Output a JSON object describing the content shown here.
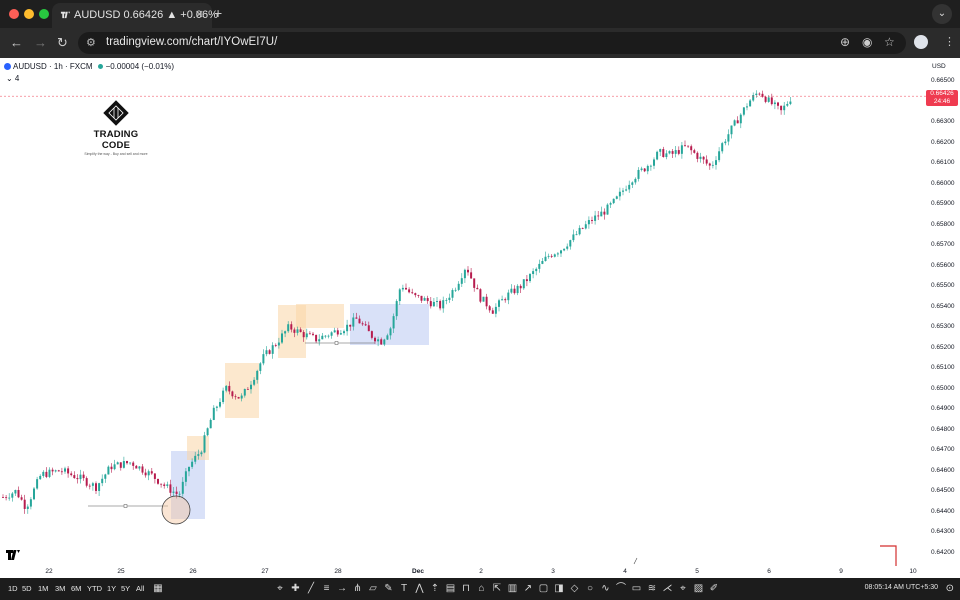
{
  "browser": {
    "tab_title": "AUDUSD 0.66426 ▲ +0.06%",
    "tab_close": "✕",
    "new_tab": "+",
    "url": "tradingview.com/chart/IYOwEI7U/",
    "colors": {
      "red": "#ff5f57",
      "yellow": "#febc2e",
      "green": "#28c840"
    }
  },
  "chart_header": {
    "symbol": "AUDUSD · 1h · FXCM",
    "change": "−0.00004 (−0.01%)",
    "collapse": "⌄ 4"
  },
  "logo": {
    "brand": "TRADING CODE",
    "tagline": "Simplify the way - Buy and sell and more"
  },
  "price_axis": {
    "currency": "USD",
    "current_price": "0.66426",
    "countdown": "24:46",
    "labels": [
      "0.66500",
      "0.66400",
      "0.66300",
      "0.66200",
      "0.66100",
      "0.66000",
      "0.65900",
      "0.65800",
      "0.65700",
      "0.65600",
      "0.65500",
      "0.65400",
      "0.65300",
      "0.65200",
      "0.65100",
      "0.65000",
      "0.64900",
      "0.64800",
      "0.64700",
      "0.64600",
      "0.64500",
      "0.64400",
      "0.64300",
      "0.64200"
    ]
  },
  "time_axis": {
    "labels": [
      "22",
      "25",
      "26",
      "27",
      "28",
      "Dec",
      "2",
      "3",
      "4",
      "5",
      "6",
      "9",
      "10"
    ]
  },
  "toolbar": {
    "timeframes": [
      "1D",
      "5D",
      "1M",
      "3M",
      "6M",
      "YTD",
      "1Y",
      "5Y",
      "All"
    ],
    "clock": "08:05:14 AM UTC+5:30"
  },
  "chart_data": {
    "type": "candlestick",
    "symbol": "AUDUSD",
    "interval": "1h",
    "ylim": [
      0.6418,
      0.6656
    ],
    "series": [
      {
        "x": "22",
        "y": 0.6452
      },
      {
        "x": "25",
        "y": 0.6462
      },
      {
        "x": "26",
        "y": 0.6447
      },
      {
        "x": "26",
        "y": 0.6495
      },
      {
        "x": "27",
        "y": 0.6528
      },
      {
        "x": "28",
        "y": 0.6525
      },
      {
        "x": "Dec",
        "y": 0.6548
      },
      {
        "x": "2",
        "y": 0.6545
      },
      {
        "x": "3",
        "y": 0.6568
      },
      {
        "x": "4",
        "y": 0.6606
      },
      {
        "x": "5",
        "y": 0.661
      },
      {
        "x": "6",
        "y": 0.6644
      }
    ],
    "colors": {
      "up": "#26a69a",
      "down": "#b71c4e",
      "zone_orange": "#f9d6a6",
      "zone_blue": "#b9c8f2"
    }
  }
}
